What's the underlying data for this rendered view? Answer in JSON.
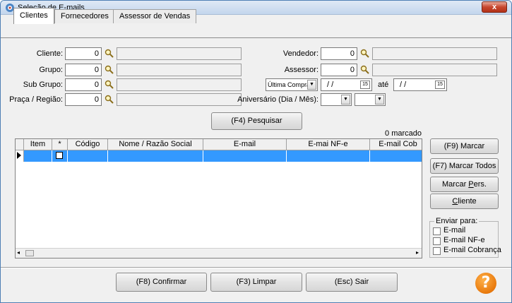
{
  "window": {
    "title": "Seleção de E-mails",
    "close_label": "x"
  },
  "tabs": [
    {
      "label": "Clientes",
      "active": true
    },
    {
      "label": "Fornecedores",
      "active": false
    },
    {
      "label": "Assessor de Vendas",
      "active": false
    }
  ],
  "filters": {
    "cliente": {
      "label": "Cliente:",
      "value": "0"
    },
    "grupo": {
      "label": "Grupo:",
      "value": "0"
    },
    "sub_grupo": {
      "label": "Sub Grupo:",
      "value": "0"
    },
    "praca_regiao": {
      "label": "Praça / Região:",
      "value": "0"
    },
    "vendedor": {
      "label": "Vendedor:",
      "value": "0"
    },
    "assessor": {
      "label": "Assessor:",
      "value": "0"
    },
    "date_type": {
      "value": "Última Compra"
    },
    "date_from": {
      "value": "/  /"
    },
    "ate_label": "até",
    "date_to": {
      "value": "/  /"
    },
    "aniversario": {
      "label": "Aniversário (Dia / Mês):"
    },
    "calendar_glyph": "15"
  },
  "search_button": "(F4) Pesquisar",
  "marked_count": "0 marcado",
  "table": {
    "columns": [
      "Item",
      "*",
      "Código",
      "Nome / Razão Social",
      "E-mail",
      "E-mai NF-e",
      "E-mail Cob"
    ]
  },
  "side_buttons": {
    "marcar": "(F9) Marcar",
    "marcar_todos": "(F7) Marcar Todos",
    "marcar_pers_prefix": "Marcar ",
    "marcar_pers_u": "P",
    "marcar_pers_suffix": "ers.",
    "cliente_u": "C",
    "cliente_suffix": "liente"
  },
  "enviar_para": {
    "legend": "Enviar para:",
    "options": [
      {
        "label": "E-mail",
        "checked": false
      },
      {
        "label": "E-mail NF-e",
        "checked": false
      },
      {
        "label": "E-mail Cobrança",
        "checked": false
      }
    ]
  },
  "bottom_buttons": {
    "confirmar": "(F8) Confirmar",
    "limpar": "(F3) Limpar",
    "sair": "(Esc) Sair"
  },
  "help_glyph": "?"
}
